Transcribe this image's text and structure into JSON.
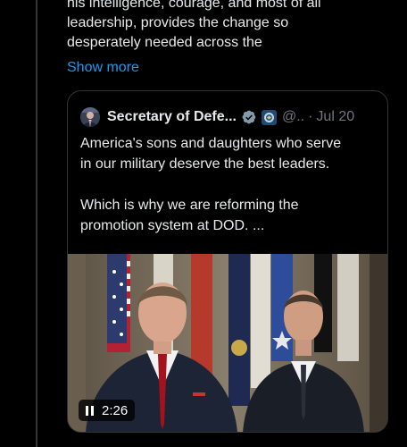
{
  "post": {
    "lines": [
      "his intelligence, courage, and most of all",
      "leadership, provides the change so",
      "desperately needed across the"
    ],
    "show_more": "Show more"
  },
  "quote": {
    "author_name": "Secretary of Defe...",
    "handle": "@..",
    "separator": "·",
    "date": "Jul 20",
    "text_p1": [
      "America's sons and daughters who serve",
      "in our military deserve the best leaders."
    ],
    "text_p2": [
      "Which is why we are reforming the",
      "promotion system at DOD. ..."
    ],
    "video": {
      "duration": "2:26",
      "state_icon": "pause-icon"
    }
  },
  "colors": {
    "background": "#000000",
    "text": "#e7e9ea",
    "muted": "#71767b",
    "link": "#1d9bf0",
    "border": "#2f3336",
    "verified": "#829aab"
  }
}
